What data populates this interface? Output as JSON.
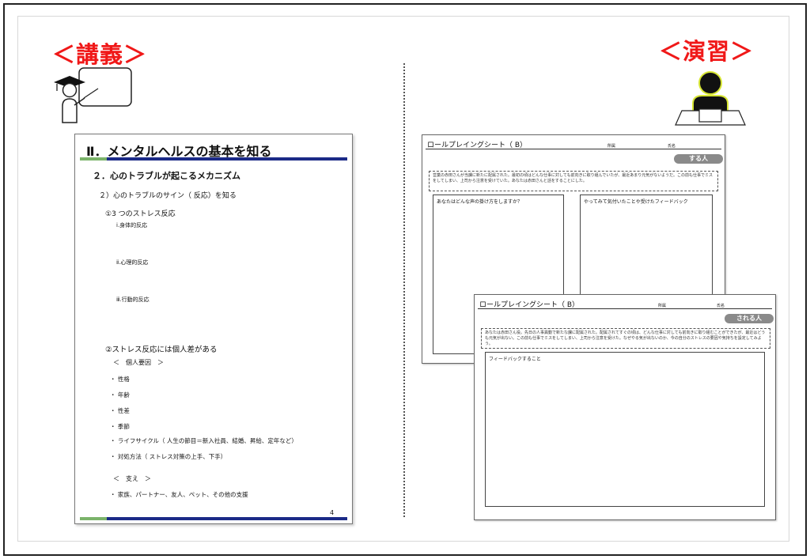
{
  "headings": {
    "lecture": "＜講義＞",
    "exercise": "＜演習＞"
  },
  "slide": {
    "title": "Ⅱ．メンタルヘルスの基本を知る",
    "section": "２．心のトラブルが起こるメカニズム",
    "subsection": "２）心のトラブルのサイン（ 反応）を知る",
    "item1": "①3 つのストレス反応",
    "reactions": [
      "ⅰ.身体的反応",
      "ⅱ.心理的反応",
      "ⅲ.行動的反応"
    ],
    "item2": "②ストレス反応には個人差がある",
    "factors_header": "＜　個人要因　＞",
    "factors": [
      "・ 性格",
      "・ 年齢",
      "・ 性差",
      "・ 季節",
      "・ ライフサイクル（ 人生の節目＝新入社員、結婚、昇給、定年など）",
      "・ 対処方法（ ストレス対策の上手、下手）"
    ],
    "support_header": "＜　支え　＞",
    "support": "・ 家族、パートナー、友人、ペット、その他の支援",
    "page": "4"
  },
  "sheet1": {
    "title": "ロールプレイングシート（ B）",
    "dept_label": "所属",
    "name_label": "氏名",
    "badge": "する人",
    "scenario": "営業の赤田さんが当課に新たに配属された。最初の頃はどんな仕事に対しても前向きに取り組んでいたが、最近あまり元気がないようだ。この前も仕事でミスをしてしまい、上司から注意を受けていた。あなたは赤田さんと話をすることにした。",
    "box_left": "あなたはどんな声の掛け方をしますか？",
    "box_right": "やってみて気付いたことや受けたフィードバック"
  },
  "sheet2": {
    "title": "ロールプレイングシート（ B）",
    "dept_label": "所属",
    "name_label": "氏名",
    "badge": "される人",
    "scenario": "あなたは赤田さん役。先日の人事異動で新たな課に配属された。配属されてすぐの頃は、どんな仕事に対しても前向きに取り組むことができたが、最近はどうも元気が出ない。この前も仕事でミスをしてしまい、上司から注意を受けた。なぜやる気が出ないのか、今の自分のストレスの要因や気持ちを設定してみよう。",
    "box": "フィードバックすること"
  }
}
